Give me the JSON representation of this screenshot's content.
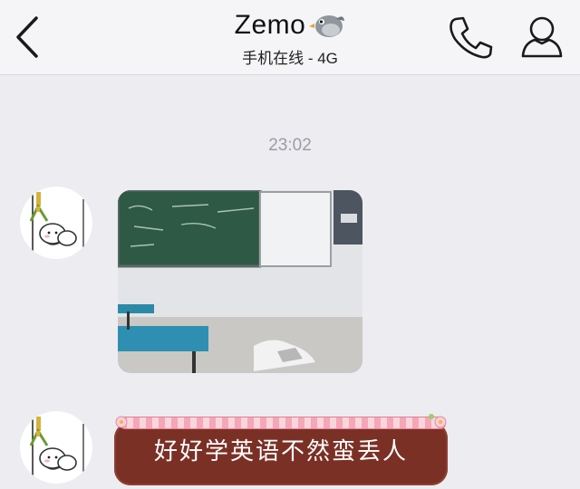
{
  "header": {
    "contact_name": "Zemo",
    "status": "手机在线 - 4G"
  },
  "icons": {
    "back": "chevron-left-icon",
    "name_emoji": "bird-icon",
    "call": "phone-icon",
    "profile": "person-icon"
  },
  "chat": {
    "timestamp": "23:02",
    "messages": [
      {
        "type": "image",
        "description_icon": "classroom-photo-thumbnail"
      },
      {
        "type": "text",
        "text": "好好学英语不然蛮丢人"
      }
    ]
  },
  "colors": {
    "background": "#ececf1",
    "topbar": "#f5f5f7",
    "text_bubble": "#7b3026",
    "ribbon": "#f4a7b6"
  }
}
